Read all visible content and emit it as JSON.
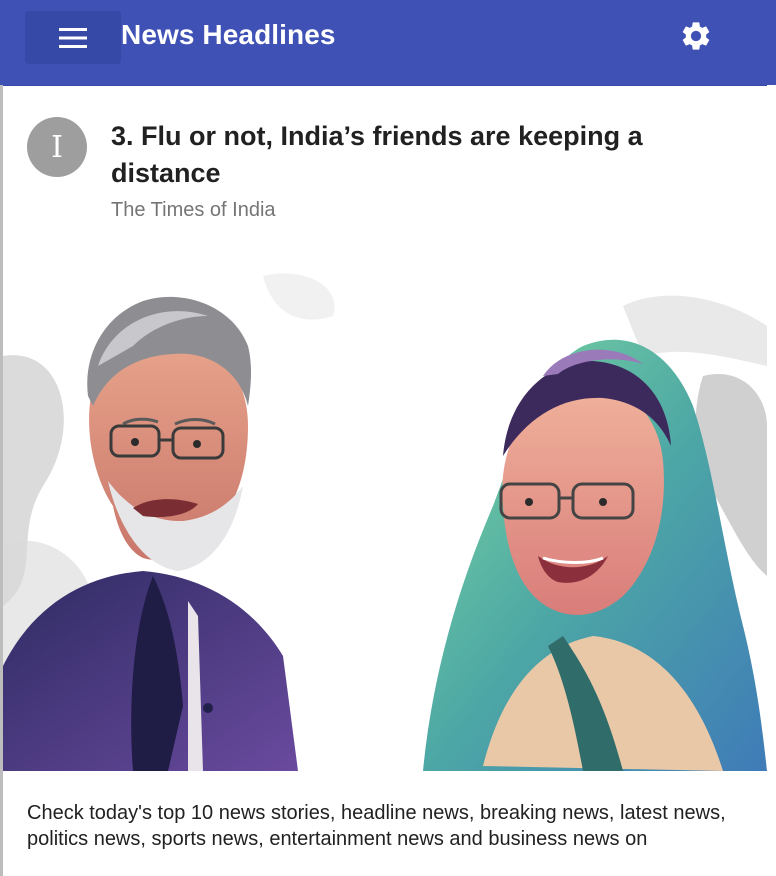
{
  "appbar": {
    "title": "News Headlines",
    "menu_icon": "menu-icon",
    "settings_icon": "gear-icon",
    "color": "#3f51b5"
  },
  "article": {
    "avatar_letter": "I",
    "headline": "3. Flu or not, India’s friends are keeping a distance",
    "source": "The Times of India",
    "image_alt": "Illustrated portraits of Narendra Modi and Sheikh Hasina",
    "description": "Check today's top 10 news stories, headline news, breaking news, latest news, politics news, sports news, entertainment news and business news on"
  }
}
